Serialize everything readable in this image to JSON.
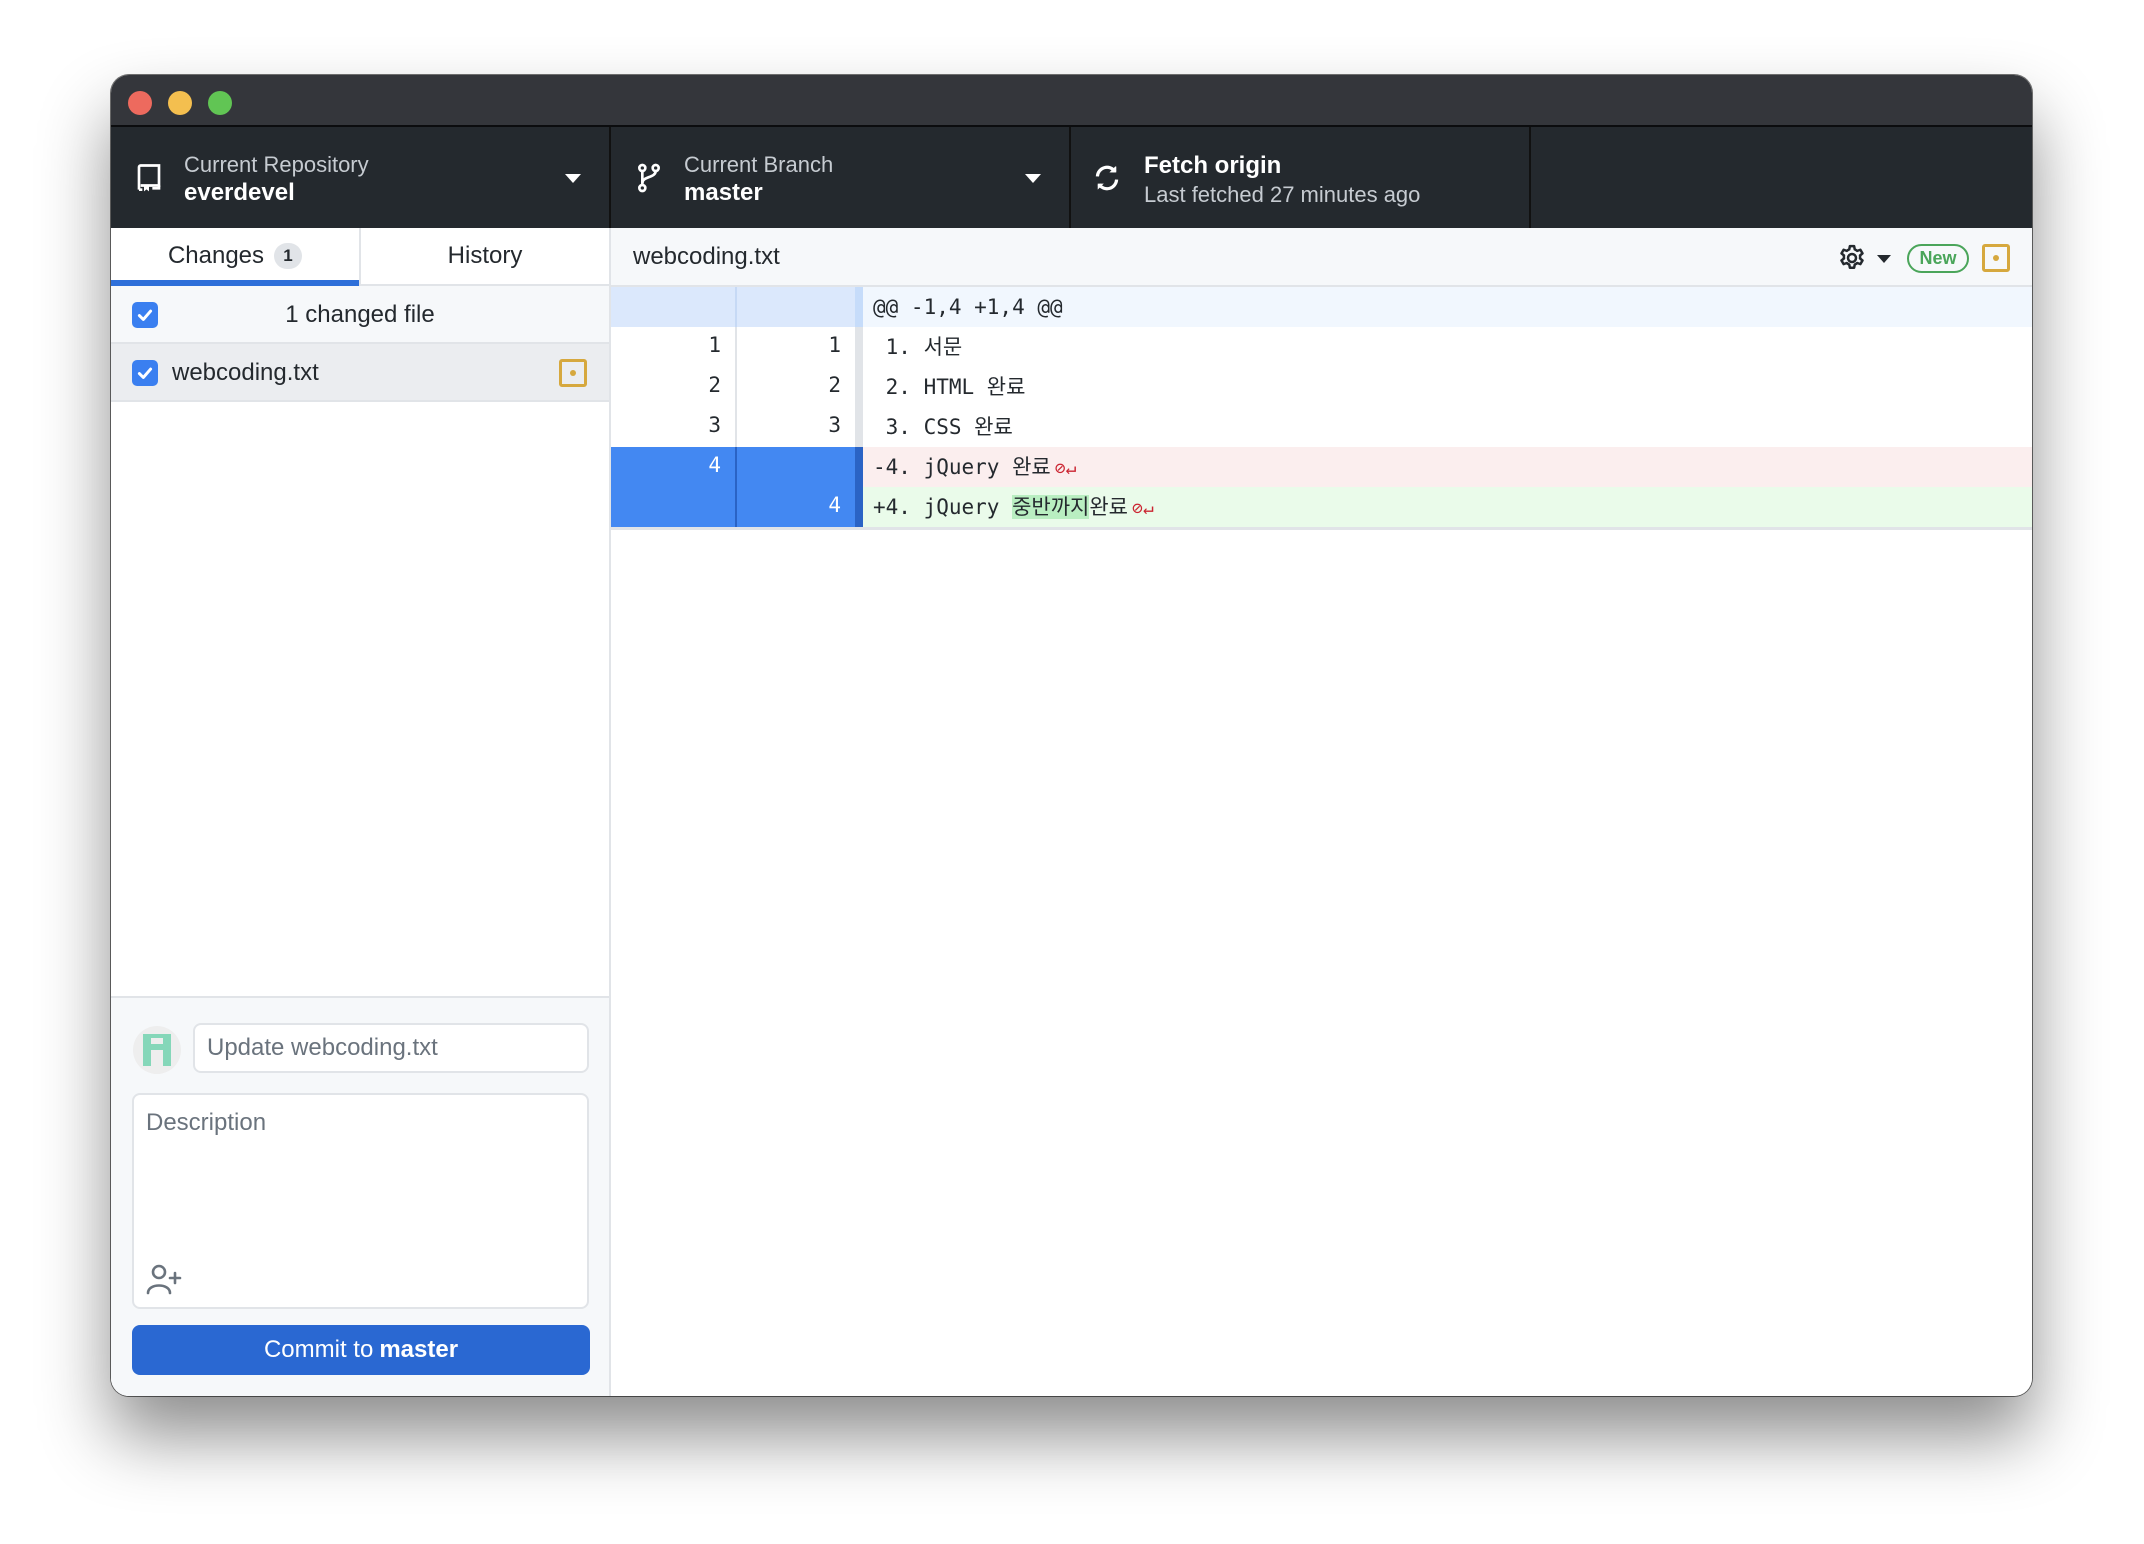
{
  "window": {
    "traffic_lights": [
      "close",
      "minimize",
      "zoom"
    ]
  },
  "toolbar": {
    "repository": {
      "caption": "Current Repository",
      "value": "everdevel",
      "icon": "repo-icon"
    },
    "branch": {
      "caption": "Current Branch",
      "value": "master",
      "icon": "git-branch-icon"
    },
    "fetch": {
      "title": "Fetch origin",
      "caption": "Last fetched 27 minutes ago",
      "icon": "sync-icon"
    }
  },
  "sidebar": {
    "tabs": [
      {
        "label": "Changes",
        "count": "1",
        "selected": true
      },
      {
        "label": "History",
        "selected": false
      }
    ],
    "changes_header": "1 changed file",
    "files": [
      {
        "name": "webcoding.txt",
        "checked": true,
        "status": "modified"
      }
    ],
    "commit": {
      "summary_placeholder": "Update webcoding.txt",
      "summary_value": "",
      "description_placeholder": "Description",
      "button_prefix": "Commit to",
      "button_branch": "master"
    }
  },
  "diff": {
    "filename": "webcoding.txt",
    "badge": "New",
    "colors": {
      "added": "#eafbea",
      "deleted": "#fbeeee",
      "selected_gutter": "#4388f2",
      "accent": "#2a68d2"
    },
    "hunk_header": "@@ -1,4 +1,4 @@",
    "lines": [
      {
        "type": "context",
        "old": "1",
        "new": "1",
        "text": " 1. 서문"
      },
      {
        "type": "context",
        "old": "2",
        "new": "2",
        "text": " 2. HTML 완료"
      },
      {
        "type": "context",
        "old": "3",
        "new": "3",
        "text": " 3. CSS 완료"
      },
      {
        "type": "delete",
        "old": "4",
        "new": "",
        "text": "-4. jQuery 완료",
        "no_newline": "⊘↵"
      },
      {
        "type": "add",
        "old": "",
        "new": "4",
        "prefix": "+4. jQuery ",
        "highlight": "중반까지",
        "suffix": "완료",
        "no_newline": "⊘↵"
      }
    ]
  }
}
